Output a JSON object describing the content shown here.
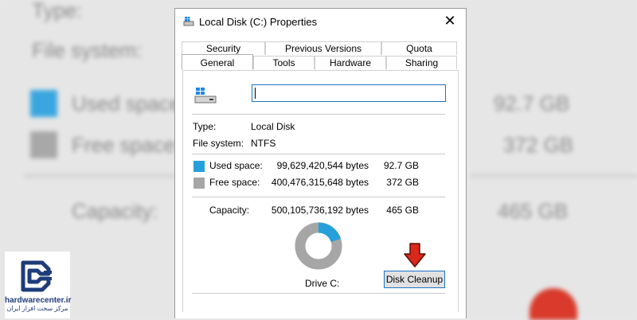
{
  "background_blur": {
    "lines": [
      "Type:",
      "File system:",
      "Used space:",
      "Free space:",
      "Capacity:"
    ],
    "values": [
      "92.7 GB",
      "372 GB",
      "465 GB"
    ]
  },
  "watermark": {
    "site": "hardwarecenter.ir",
    "tagline": "مرکز سخت افزار ایران"
  },
  "dialog": {
    "title": "Local Disk (C:) Properties",
    "close_glyph": "✕",
    "tabs_top": [
      "Security",
      "Previous Versions",
      "Quota"
    ],
    "tabs_bottom": [
      "General",
      "Tools",
      "Hardware",
      "Sharing"
    ],
    "active_tab": "General",
    "name_value": "",
    "type_label": "Type:",
    "type_value": "Local Disk",
    "fs_label": "File system:",
    "fs_value": "NTFS",
    "used_label": "Used space:",
    "used_bytes": "99,629,420,544 bytes",
    "used_gb": "92.7 GB",
    "free_label": "Free space:",
    "free_bytes": "400,476,315,648 bytes",
    "free_gb": "372 GB",
    "capacity_label": "Capacity:",
    "capacity_bytes": "500,105,736,192 bytes",
    "capacity_gb": "465 GB",
    "drive_label": "Drive C:",
    "cleanup_button": "Disk Cleanup",
    "used_fraction": 0.1992,
    "colors": {
      "used": "#26a0da",
      "free": "#a6a6a6",
      "accent": "#1c73c5",
      "arrow": "#d9291c"
    }
  }
}
